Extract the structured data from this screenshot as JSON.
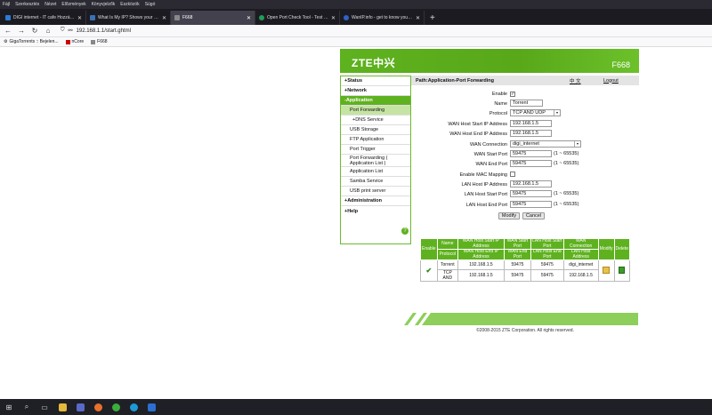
{
  "menu": [
    "Fájl",
    "Szerkesztés",
    "Nézet",
    "Előzmények",
    "Könyvjelzők",
    "Eszközök",
    "Súgó"
  ],
  "tabs": [
    {
      "title": "DIGI internet - IT cafe Hozzászólás",
      "color": "#2a7cd6"
    },
    {
      "title": "What Is My IP? Shows your real IP",
      "color": "#3a70b8"
    },
    {
      "title": "F668",
      "color": "#888888",
      "active": true
    },
    {
      "title": "Open Port Check Tool - Test Port",
      "color": "#1f9e57"
    },
    {
      "title": "WanIP.info - get to know your IP",
      "color": "#2d62c9"
    }
  ],
  "address": {
    "url": "192.168.1.1/start.ghtml"
  },
  "bookmarks": [
    "GigaTorrents :: Bejelen...",
    "nCore",
    "F668"
  ],
  "router": {
    "brand": "ZTE中兴",
    "model": "F668",
    "path": "Path:Application-Port Forwarding",
    "lang": "中 文",
    "logout": "Logout",
    "accent": "#5fb21f",
    "sidebar": {
      "status": "+Status",
      "network": "+Network",
      "application": "-Application",
      "items": [
        "Port Forwarding",
        "+DNS Service",
        "USB Storage",
        "FTP Application",
        "Port Trigger",
        "Port Forwarding ( Application List )",
        "Application List",
        "Samba Service",
        "USB print server"
      ],
      "administration": "+Administration",
      "help": "+Help"
    },
    "form": {
      "enable_label": "Enable",
      "name_label": "Name",
      "name_value": "Torrent",
      "protocol_label": "Protocol",
      "protocol_value": "TCP AND UDP",
      "wan_start_ip_label": "WAN Host Start IP Address",
      "wan_start_ip": "192.168.1.5",
      "wan_end_ip_label": "WAN Host End IP Address",
      "wan_end_ip": "192.168.1.5",
      "wan_conn_label": "WAN Connection",
      "wan_conn": "digi_internet",
      "wan_start_port_label": "WAN Start Port",
      "wan_start_port": "59475",
      "wan_end_port_label": "WAN End Port",
      "wan_end_port": "59475",
      "mac_label": "Enable MAC Mapping",
      "lan_ip_label": "LAN Host IP Address",
      "lan_ip": "192.168.1.5",
      "lan_start_port_label": "LAN Host Start Port",
      "lan_start_port": "59475",
      "lan_end_port_label": "LAN Host End Port",
      "lan_end_port": "59475",
      "range_hint": "(1 ~ 65535)",
      "modify": "Modify",
      "cancel": "Cancel"
    },
    "table": {
      "h_enable": "Enable",
      "h_name": "Name",
      "h_protocol": "Protocol",
      "h_wan_start_ip": "WAN Host Start IP Address",
      "h_wan_end_ip": "WAN Host End IP Address",
      "h_wan_start_port": "WAN Start Port",
      "h_wan_end_port": "WAN End Port",
      "h_lan_start": "LAN Host Start Port",
      "h_lan_end": "LAN Host End Port",
      "h_wan_conn": "WAN Connection",
      "h_lan_ip": "LAN Host Address",
      "h_modify": "Modify",
      "h_delete": "Delete",
      "row": {
        "name": "Torrent",
        "protocol": "TCP AND",
        "wan_start_ip": "192.168.1.5",
        "wan_end_ip": "192.168.1.5",
        "wan_start_port": "59475",
        "wan_end_port": "59475",
        "lan_start": "59475",
        "lan_end": "59475",
        "wan_conn": "digi_internet",
        "lan_ip": "192.168.1.5"
      }
    },
    "copyright": "©2008-2015 ZTE Corporation. All rights reserved."
  }
}
